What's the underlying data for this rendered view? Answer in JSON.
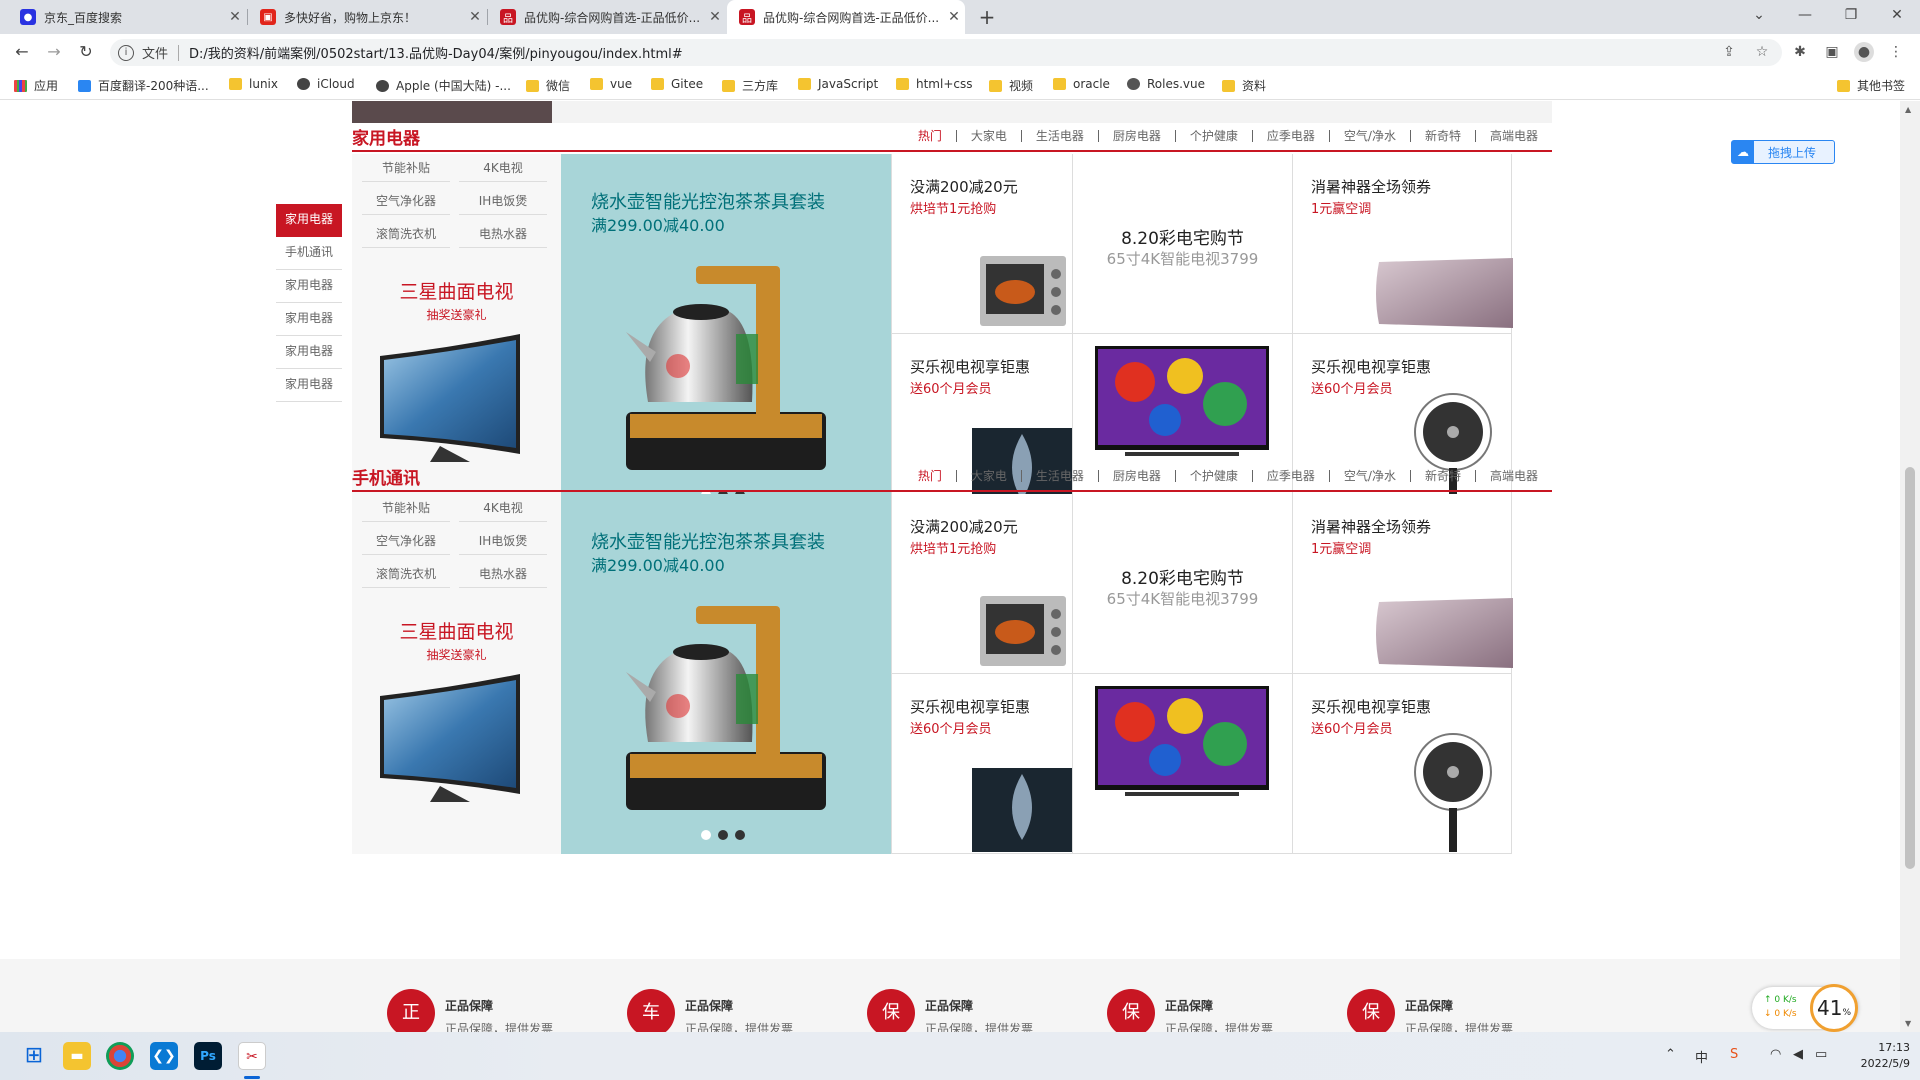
{
  "tabs": [
    {
      "title": "京东_百度搜索",
      "icon": "baidu-icon",
      "color": "#2932e1"
    },
    {
      "title": "多快好省，购物上京东！",
      "icon": "jd-icon",
      "color": "#e1251b"
    },
    {
      "title": "品优购-综合网购首选-正品低价...",
      "icon": "pinyougou-icon",
      "color": "#c81623"
    },
    {
      "title": "品优购-综合网购首选-正品低价...",
      "icon": "pinyougou-icon",
      "color": "#c81623"
    }
  ],
  "address": {
    "label": "文件",
    "url": "D:/我的资料/前端案例/0502start/13.品优购-Day04/案例/pinyougou/index.html#"
  },
  "bookmarks": [
    "应用",
    "百度翻译-200种语...",
    "lunix",
    "iCloud",
    "Apple (中国大陆) -...",
    "微信",
    "vue",
    "Gitee",
    "三方库",
    "JavaScript",
    "html+css",
    "视频",
    "oracle",
    "Roles.vue",
    "资料"
  ],
  "other_bookmarks": "其他书签",
  "left_nav": [
    "家用电器",
    "手机通讯",
    "家用电器",
    "家用电器",
    "家用电器",
    "家用电器"
  ],
  "floors": [
    {
      "title": "家用电器",
      "tabs": [
        "热门",
        "大家电",
        "生活电器",
        "厨房电器",
        "个护健康",
        "应季电器",
        "空气/净水",
        "新奇特",
        "高端电器"
      ],
      "keywords": [
        "节能补贴",
        "4K电视",
        "空气净化器",
        "IH电饭煲",
        "滚筒洗衣机",
        "电热水器"
      ],
      "promo_title": "三星曲面电视",
      "promo_sub": "抽奖送豪礼",
      "banner_title": "烧水壶智能光控泡茶茶具套装",
      "banner_sub": "满299.00减40.00",
      "cells": [
        {
          "title": "没满200减20元",
          "sub": "烘培节1元抢购"
        },
        {
          "title": "8.20彩电宅购节",
          "sub": "65寸4K智能电视3799"
        },
        {
          "title": "消暑神器全场领券",
          "sub": "1元赢空调"
        },
        {
          "title": "买乐视电视享钜惠",
          "sub": "送60个月会员"
        },
        {
          "title": "买乐视电视享钜惠",
          "sub": "送60个月会员"
        }
      ]
    },
    {
      "title": "手机通讯",
      "tabs": [
        "热门",
        "大家电",
        "生活电器",
        "厨房电器",
        "个护健康",
        "应季电器",
        "空气/净水",
        "新奇特",
        "高端电器"
      ],
      "keywords": [
        "节能补贴",
        "4K电视",
        "空气净化器",
        "IH电饭煲",
        "滚筒洗衣机",
        "电热水器"
      ],
      "promo_title": "三星曲面电视",
      "promo_sub": "抽奖送豪礼",
      "banner_title": "烧水壶智能光控泡茶茶具套装",
      "banner_sub": "满299.00减40.00",
      "cells": [
        {
          "title": "没满200减20元",
          "sub": "烘培节1元抢购"
        },
        {
          "title": "8.20彩电宅购节",
          "sub": "65寸4K智能电视3799"
        },
        {
          "title": "消暑神器全场领券",
          "sub": "1元赢空调"
        },
        {
          "title": "买乐视电视享钜惠",
          "sub": "送60个月会员"
        },
        {
          "title": "买乐视电视享钜惠",
          "sub": "送60个月会员"
        }
      ]
    }
  ],
  "services": [
    {
      "icon": "正",
      "title": "正品保障",
      "sub": "正品保障，提供发票"
    },
    {
      "icon": "车",
      "title": "正品保障",
      "sub": "正品保障，提供发票"
    },
    {
      "icon": "保",
      "title": "正品保障",
      "sub": "正品保障，提供发票"
    },
    {
      "icon": "保",
      "title": "正品保障",
      "sub": "正品保障，提供发票"
    },
    {
      "icon": "保",
      "title": "正品保障",
      "sub": "正品保障，提供发票"
    }
  ],
  "upload_label": "拖拽上传",
  "speed": {
    "up": "0  K/s",
    "down": "0  K/s",
    "percent": "41",
    "percent_unit": "%"
  },
  "clock": {
    "time": "17:13",
    "date": "2022/5/9"
  },
  "tray": {
    "ime": "中"
  }
}
